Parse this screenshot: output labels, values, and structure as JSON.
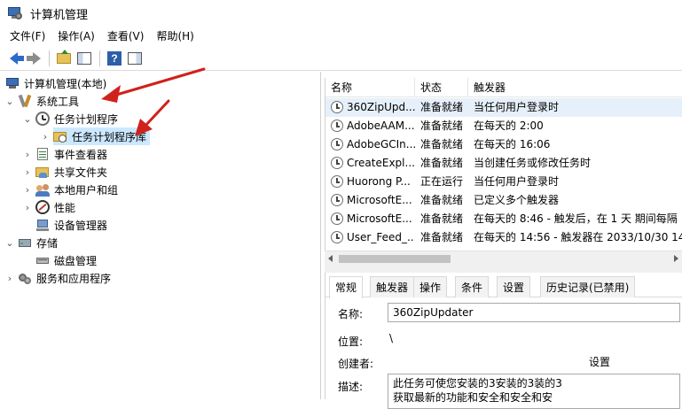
{
  "window": {
    "title": "计算机管理"
  },
  "menu": [
    "文件(F)",
    "操作(A)",
    "查看(V)",
    "帮助(H)"
  ],
  "toolbar": {
    "back": "back-arrow-icon",
    "forward": "forward-arrow-icon",
    "up": "folder-up-icon",
    "console_tree": "console-tree-icon",
    "help": "help-icon",
    "action_pane": "action-pane-icon"
  },
  "tree": {
    "root": "计算机管理(本地)",
    "system_tools": "系统工具",
    "task_scheduler": "任务计划程序",
    "task_library": "任务计划程序库",
    "event_viewer": "事件查看器",
    "shared_folders": "共享文件夹",
    "local_users": "本地用户和组",
    "performance": "性能",
    "device_manager": "设备管理器",
    "storage": "存储",
    "disk_management": "磁盘管理",
    "services": "服务和应用程序"
  },
  "tasks": {
    "columns": [
      "名称",
      "状态",
      "触发器"
    ],
    "rows": [
      {
        "name": "360ZipUpd...",
        "status": "准备就绪",
        "trigger": "当任何用户登录时"
      },
      {
        "name": "AdobeAAM...",
        "status": "准备就绪",
        "trigger": "在每天的 2:00"
      },
      {
        "name": "AdobeGCIn...",
        "status": "准备就绪",
        "trigger": "在每天的 16:06"
      },
      {
        "name": "CreateExpl...",
        "status": "准备就绪",
        "trigger": "当创建任务或修改任务时"
      },
      {
        "name": "Huorong P...",
        "status": "正在运行",
        "trigger": "当任何用户登录时"
      },
      {
        "name": "MicrosoftE...",
        "status": "准备就绪",
        "trigger": "已定义多个触发器"
      },
      {
        "name": "MicrosoftE...",
        "status": "准备就绪",
        "trigger": "在每天的 8:46 - 触发后，在 1 天 期间每隔"
      },
      {
        "name": "User_Feed_...",
        "status": "准备就绪",
        "trigger": "在每天的 14:56 - 触发器在 2033/10/30 14"
      }
    ]
  },
  "properties": {
    "tabs": [
      "常规",
      "触发器",
      "操作",
      "条件",
      "设置",
      "历史记录(已禁用)"
    ],
    "name_label": "名称:",
    "name_value": "360ZipUpdater",
    "location_label": "位置:",
    "location_value": "\\",
    "author_label": "创建者:",
    "settings_btn": "设置",
    "desc_label": "描述:",
    "desc_line1": "此任务可使您安装的3安装的3装的3",
    "desc_line2": "获取最新的功能和安全和安全和安"
  },
  "colors": {
    "annotation_arrow": "#d0211c",
    "selection": "#cce8ff"
  }
}
